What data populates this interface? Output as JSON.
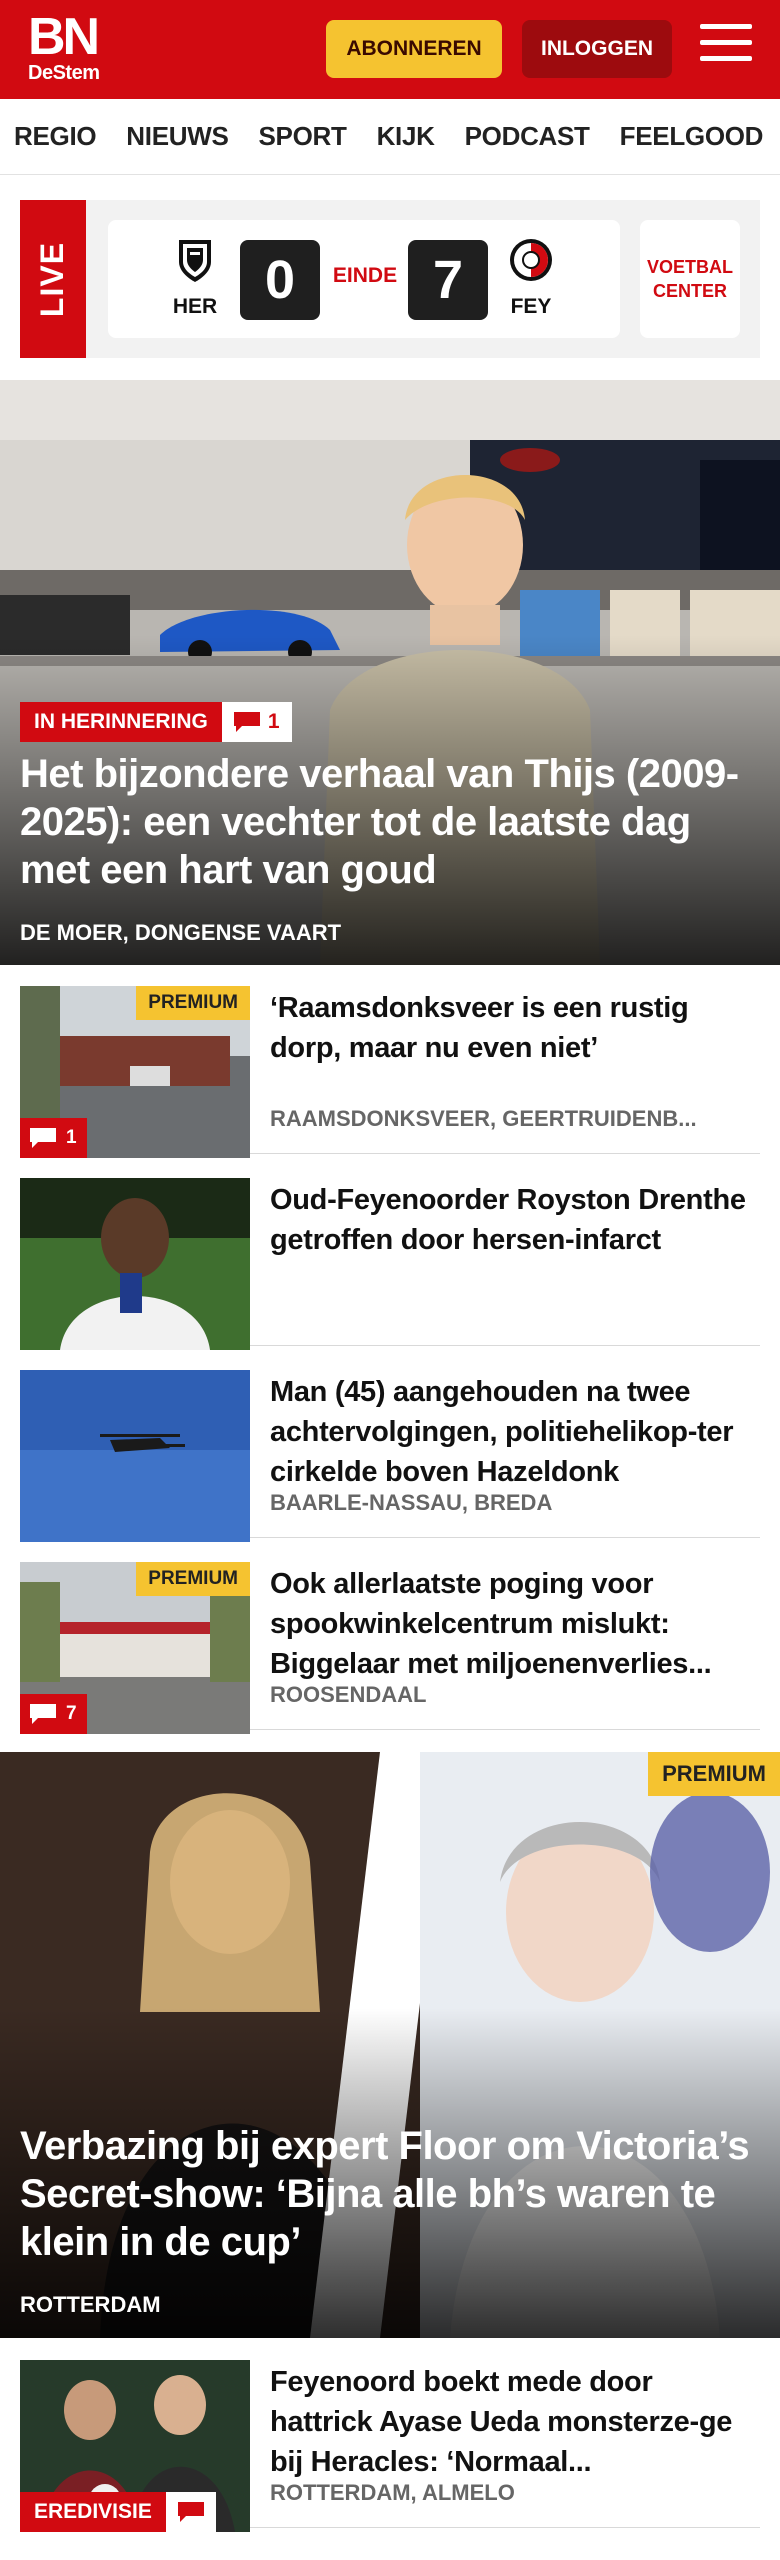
{
  "header": {
    "logo_main": "BN",
    "logo_sub": "DeStem",
    "subscribe_label": "ABONNEREN",
    "login_label": "INLOGGEN"
  },
  "nav": {
    "items": [
      "REGIO",
      "NIEUWS",
      "SPORT",
      "KIJK",
      "PODCAST",
      "FEELGOOD"
    ]
  },
  "live": {
    "label": "LIVE",
    "home_team": "HER",
    "away_team": "FEY",
    "home_score": "0",
    "away_score": "7",
    "status": "EINDE",
    "voetbal_center_line1": "VOETBAL",
    "voetbal_center_line2": "CENTER"
  },
  "hero": {
    "tag": "IN HERINNERING",
    "comment_count": "1",
    "title": "Het bijzondere verhaal van Thijs (2009-2025): een vechter tot de laatste dag met een hart van goud",
    "meta": "DE MOER, DONGENSE VAART"
  },
  "articles": [
    {
      "premium": "PREMIUM",
      "comment_count": "1",
      "title": "‘Raamsdonksveer is een rustig dorp, maar nu even niet’",
      "meta": "RAAMSDONKSVEER, GEERTRUIDENB..."
    },
    {
      "title": "Oud-Feyenoorder Royston Drenthe getroffen door hersen-infarct",
      "meta": ""
    },
    {
      "title": "Man (45) aangehouden na twee achtervolgingen, politiehelikop-ter cirkelde boven Hazeldonk",
      "meta": "BAARLE-NASSAU, BREDA"
    },
    {
      "premium": "PREMIUM",
      "comment_count": "7",
      "title": "Ook allerlaatste poging voor spookwinkelcentrum mislukt: Biggelaar met miljoenenverlies...",
      "meta": "ROOSENDAAL"
    }
  ],
  "feature": {
    "premium": "PREMIUM",
    "title": "Verbazing bij expert Floor om Victoria’s Secret-show: ‘Bijna alle bh’s waren te klein in de cup’",
    "meta": "ROTTERDAM"
  },
  "article_last": {
    "tag": "EREDIVISIE",
    "title": "Feyenoord boekt mede door hattrick Ayase Ueda monsterze-ge bij Heracles: ‘Normaal...",
    "meta": "ROTTERDAM, ALMELO"
  },
  "colors": {
    "brand_red": "#d10a11",
    "premium_yellow": "#f5c330",
    "dark_red": "#9d0b0e"
  }
}
